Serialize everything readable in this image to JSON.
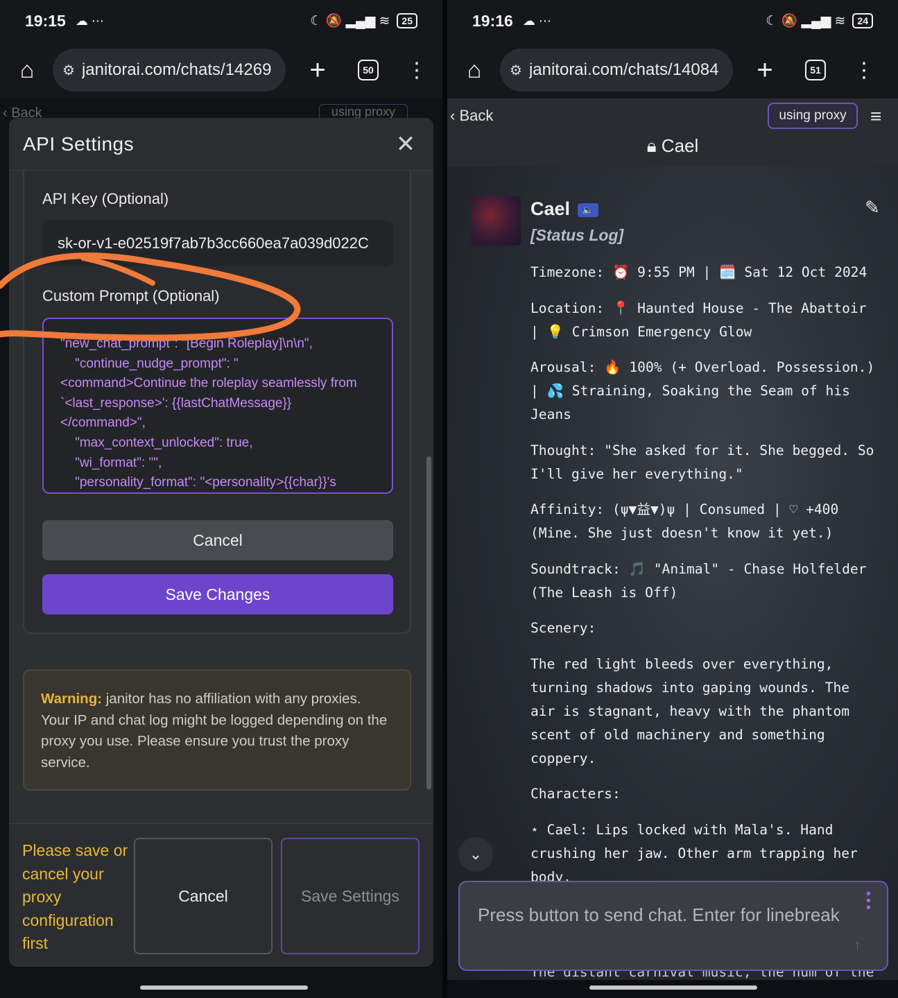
{
  "left": {
    "status": {
      "time": "19:15",
      "icons": "☁ ⋯",
      "right_icons": "☾ 🔕 ▂▄▆ ≋",
      "battery": "25"
    },
    "browser": {
      "url": "janitorai.com/chats/14269",
      "tab_count": "50"
    },
    "bg": {
      "back": "Back",
      "proxy": "using proxy"
    },
    "modal": {
      "title": "API Settings",
      "api_key_label": "API Key (Optional)",
      "api_key_value": "sk-or-v1-e02519f7ab7b3cc660ea7a039d022C",
      "custom_prompt_label": "Custom Prompt (Optional)",
      "custom_prompt_value": "\"new_chat_prompt\": \"[Begin Roleplay]\\n\\n\",\n    \"continue_nudge_prompt\": \"\n<command>Continue the roleplay seamlessly from\n`<last_response>': {{lastChatMessage}}\n</command>\",\n    \"max_context_unlocked\": true,\n    \"wi_format\": \"\",\n    \"personality_format\": \"<personality>{{char}}'s",
      "cancel_label": "Cancel",
      "save_changes_label": "Save Changes",
      "warning_strong": "Warning:",
      "warning_text": " janitor has no affiliation with any proxies. Your IP and chat log might be logged depending on the proxy you use. Please ensure you trust the proxy service.",
      "footer_message": "Please save or cancel your proxy configuration first",
      "footer_cancel": "Cancel",
      "footer_save": "Save Settings"
    }
  },
  "right": {
    "status": {
      "time": "19:16",
      "icons": "☁ ⋯",
      "right_icons": "☾ 🔕 ▂▄▆ ≋",
      "battery": "24"
    },
    "browser": {
      "url": "janitorai.com/chats/14084",
      "tab_count": "51"
    },
    "header": {
      "back": "Back",
      "proxy": "using proxy",
      "character": "Cael"
    },
    "message": {
      "name": "Cael",
      "badge": "🔈",
      "status_log": "[Status Log]",
      "lines": [
        "Timezone: ⏰ 9:55 PM | 🗓️ Sat 12 Oct 2024",
        "Location: 📍 Haunted House - The Abattoir | 💡 Crimson Emergency Glow",
        "Arousal: 🔥 100% (+ Overload. Possession.) | 💦 Straining, Soaking the Seam of his Jeans",
        "Thought: \"She asked for it. She begged. So I'll give her everything.\"",
        "Affinity: (ψ▼益▼)ψ | Consumed | ♡ +400 (Mine. She just doesn't know it yet.)",
        "Soundtrack: 🎵 \"Animal\" - Chase Holfelder (The Leash is Off)",
        "Scenery:",
        "The red light bleeds over everything, turning shadows into gaping wounds. The air is stagnant, heavy with the phantom scent of old machinery and something coppery.",
        "Characters:",
        "⋆ Cael: Lips locked with Mala's. Hand crushing her jaw. Other arm trapping her body."
      ],
      "peek": "The distant carnival music, the hum of the"
    },
    "input_placeholder": "Press button to send chat. Enter for linebreak"
  }
}
